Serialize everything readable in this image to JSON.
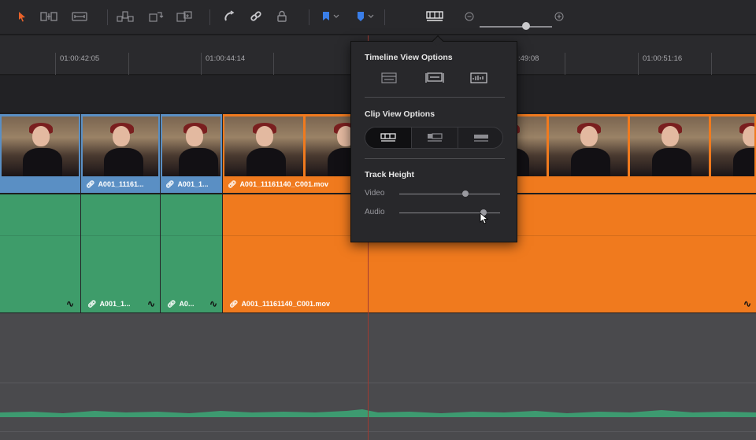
{
  "toolbar": {
    "icons": [
      "selection-arrow-icon",
      "trim-edit-icon",
      "dynamic-trim-icon",
      "overwrite-clip-icon",
      "replace-clip-icon",
      "insert-clip-icon",
      "snapping-icon",
      "linked-selection-icon",
      "position-lock-icon",
      "flag-icon",
      "flag-dropdown-icon",
      "marker-icon",
      "marker-dropdown-icon",
      "timeline-view-options-icon",
      "zoom-out-icon",
      "zoom-in-icon"
    ],
    "zoom_level": 0.65,
    "accent_color": "#e8622a",
    "flag_color": "#3a7ee8"
  },
  "ruler": {
    "timecodes": [
      "01:00:42:05",
      "01:00:44:14",
      ":49:08",
      "01:00:51:16"
    ]
  },
  "video_track": {
    "clips": [
      {
        "label": "",
        "color": "#5a8fc4"
      },
      {
        "label": "A001_11161...",
        "color": "#5a8fc4"
      },
      {
        "label": "A001_1...",
        "color": "#5a8fc4"
      },
      {
        "label": "A001_11161140_C001.mov",
        "color": "#f07a1e"
      }
    ]
  },
  "audio_track": {
    "clips": [
      {
        "label": "",
        "color": "#3e9c6a"
      },
      {
        "label": "A001_1...",
        "color": "#3e9c6a"
      },
      {
        "label": "A0...",
        "color": "#3e9c6a"
      },
      {
        "label": "A001_11161140_C001.mov",
        "color": "#f07a1e"
      }
    ]
  },
  "popup": {
    "timeline_view_title": "Timeline View Options",
    "timeline_view_icons": [
      "stacked-timelines-icon",
      "subtitle-tracks-icon",
      "audio-waveforms-icon"
    ],
    "clip_view_title": "Clip View Options",
    "clip_view_icons": [
      "filmstrip-view-icon",
      "thumbnail-view-icon",
      "simple-view-icon"
    ],
    "clip_view_selected": 0,
    "track_height_title": "Track Height",
    "video_label": "Video",
    "audio_label": "Audio",
    "video_height": 0.67,
    "audio_height": 0.85
  }
}
